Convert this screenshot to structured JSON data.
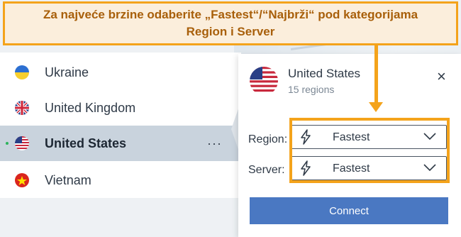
{
  "callout": {
    "text": "Za najveće brzine odaberite „Fastest“/“Najbrži“ pod kategorijama Region i Server"
  },
  "countries": [
    {
      "name": "Ukraine",
      "flag": "ukraine-flag-icon"
    },
    {
      "name": "United Kingdom",
      "flag": "uk-flag-icon"
    },
    {
      "name": "United States",
      "flag": "us-flag-icon",
      "selected": true
    },
    {
      "name": "Vietnam",
      "flag": "vietnam-flag-icon"
    }
  ],
  "more_label": "···",
  "panel": {
    "title": "United States",
    "subtitle": "15 regions",
    "close": "×",
    "region_label": "Region:",
    "region_value": "Fastest",
    "server_label": "Server:",
    "server_value": "Fastest",
    "connect_label": "Connect"
  },
  "colors": {
    "accent_orange": "#f4a31b",
    "connect_blue": "#4a78c2",
    "selected_row": "#c9d3dd",
    "active_dot": "#2cb45c"
  }
}
